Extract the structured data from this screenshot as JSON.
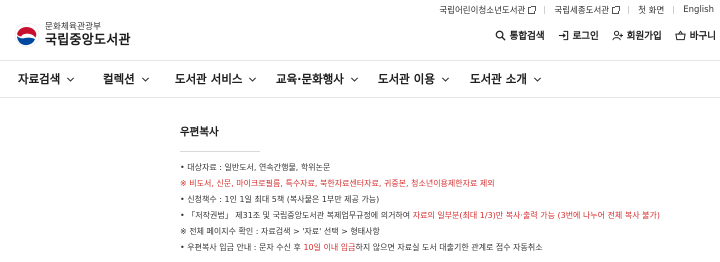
{
  "utility": {
    "kids_library": "국립어린이청소년도서관",
    "sejong_library": "국립세종도서관",
    "home": "첫 화면",
    "english": "English"
  },
  "logo": {
    "ministry": "문화체육관광부",
    "name": "국립중앙도서관"
  },
  "actions": {
    "search": "통합검색",
    "login": "로그인",
    "signup": "회원가입",
    "basket": "바구니"
  },
  "gnb": {
    "items": [
      "자료검색",
      "컬렉션",
      "도서관 서비스",
      "교육·문화행사",
      "도서관 이용",
      "도서관 소개"
    ]
  },
  "content": {
    "title": "우편복사",
    "l1": "• 대상자료 : 일반도서, 연속간행물, 학위논문",
    "l2": "※ 비도서, 신문, 마이크로필름, 특수자료, 북한자료센터자료, 귀중본, 청소년이용제한자료 제외",
    "l3": "• 신청책수 : 1인 1일 최대 5책 (복사물은 1부만 제공 가능)",
    "l4a": "• 「저작권법」 제31조 및 국립중앙도서관 복제업무규정에 의거하여 ",
    "l4b": "자료의 일부분(최대 1/3)만 복사·출력 가능 (3번에 나누어 전체 복사 불가)",
    "l5": "※ 전체 페이지수 확인 : 자료검색 > '자료' 선택 > 형태사항",
    "l6a": "• 우편복사 입금 안내 : 문자 수신 후 ",
    "l6b": "10일 이내 입금",
    "l6c": "하지 않으면 자료실 도서 대출기한 관계로 접수 자동취소"
  },
  "colors": {
    "accent_red": "#d62f2f",
    "text": "#222222"
  },
  "icons": [
    "external-link-icon",
    "search-icon",
    "login-icon",
    "user-add-icon",
    "basket-icon",
    "chevron-down-icon",
    "taegeuk-emblem-icon"
  ]
}
